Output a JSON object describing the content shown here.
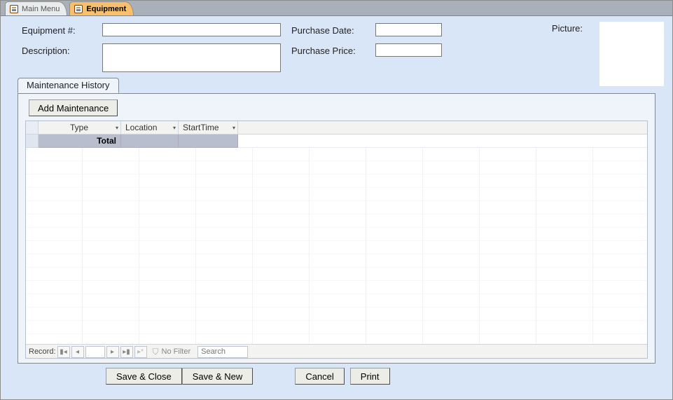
{
  "tabs": {
    "main_menu": "Main Menu",
    "equipment": "Equipment"
  },
  "form": {
    "equipment_label": "Equipment #:",
    "equipment_value": "",
    "description_label": "Description:",
    "description_value": "",
    "purchase_date_label": "Purchase Date:",
    "purchase_date_value": "",
    "purchase_price_label": "Purchase Price:",
    "purchase_price_value": "",
    "picture_label": "Picture:"
  },
  "subtab": {
    "label": "Maintenance History",
    "add_button": "Add Maintenance"
  },
  "grid": {
    "columns": [
      "Type",
      "Location",
      "StartTime"
    ],
    "total_label": "Total"
  },
  "recnav": {
    "label": "Record:",
    "nofilter": "No Filter",
    "search_placeholder": "Search"
  },
  "footer": {
    "save_close": "Save & Close",
    "save_new": "Save & New",
    "cancel": "Cancel",
    "print": "Print"
  }
}
